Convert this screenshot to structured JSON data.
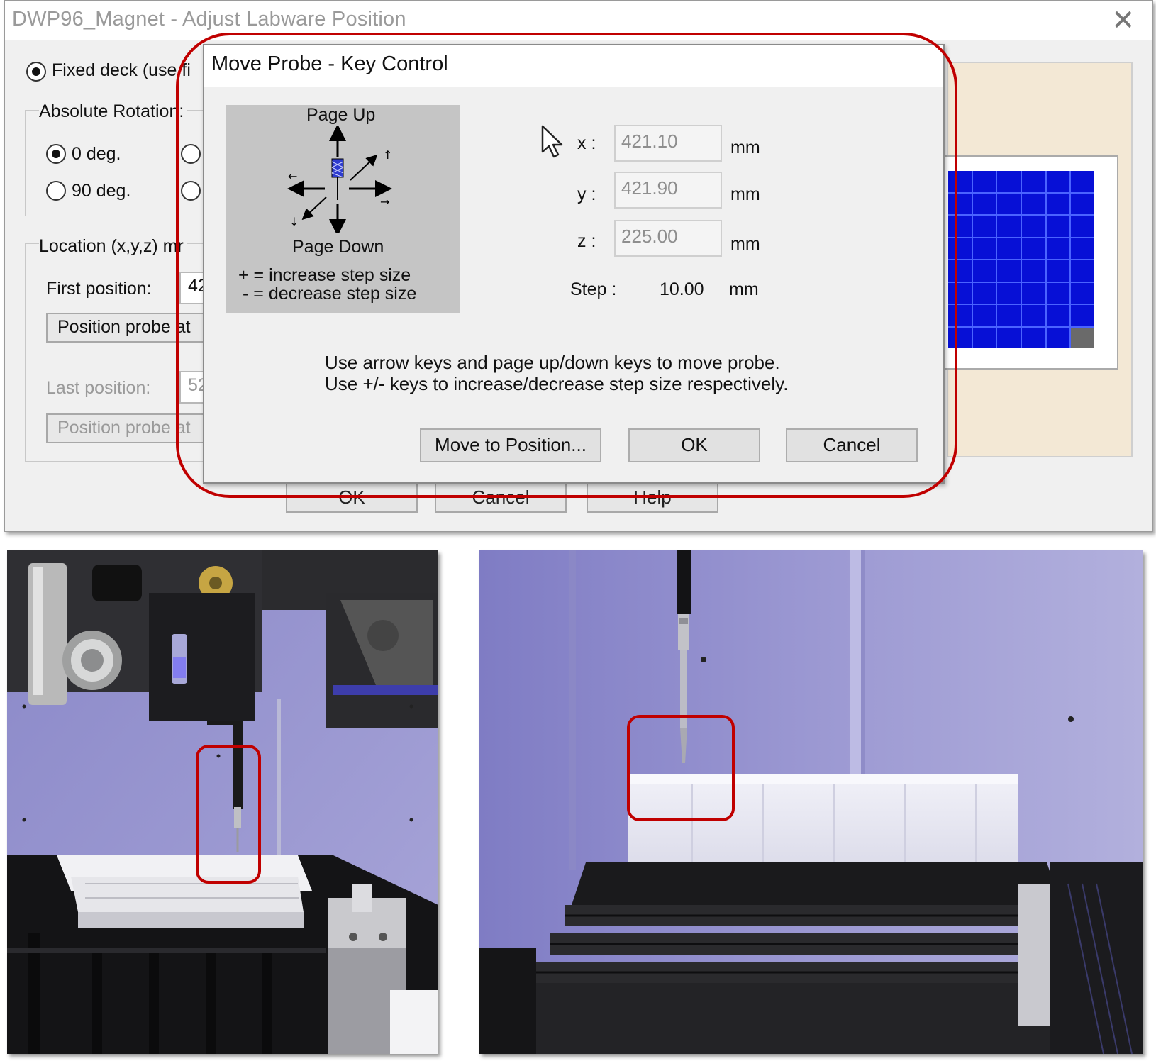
{
  "parent": {
    "title": "DWP96_Magnet - Adjust Labware Position",
    "fixed_deck_label": "Fixed deck (use fi",
    "rotation_group_label": "Absolute Rotation:",
    "rotation_options": [
      "0 deg.",
      "90 deg."
    ],
    "location_label": "Location (x,y,z) mr",
    "first_position_label": "First position:",
    "first_position_value": "42",
    "position_probe_button": "Position probe at",
    "last_position_label": "Last position:",
    "last_position_value": "52",
    "position_probe_last_button": "Position probe at",
    "bottom_buttons": {
      "ok": "OK",
      "cancel": "Cancel",
      "help": "Help"
    }
  },
  "dialog": {
    "title": "Move Probe - Key Control",
    "legend": {
      "page_up": "Page Up",
      "page_down": "Page Down",
      "increase": "+ = increase step size",
      "decrease": "- = decrease step size"
    },
    "x_label": "x :",
    "x_value": "421.10",
    "y_label": "y :",
    "y_value": "421.90",
    "z_label": "z :",
    "z_value": "225.00",
    "unit": "mm",
    "step_label": "Step :",
    "step_value": "10.00",
    "instructions": [
      "Use arrow keys and page up/down keys to move probe.",
      "Use +/- keys to increase/decrease step size respectively."
    ],
    "buttons": {
      "move": "Move to Position...",
      "ok": "OK",
      "cancel": "Cancel"
    }
  },
  "colors": {
    "highlight": "#c00000",
    "well_fill": "#0710d6",
    "well_selected": "#6a6a6a",
    "preview_background": "#f3e8d5"
  }
}
